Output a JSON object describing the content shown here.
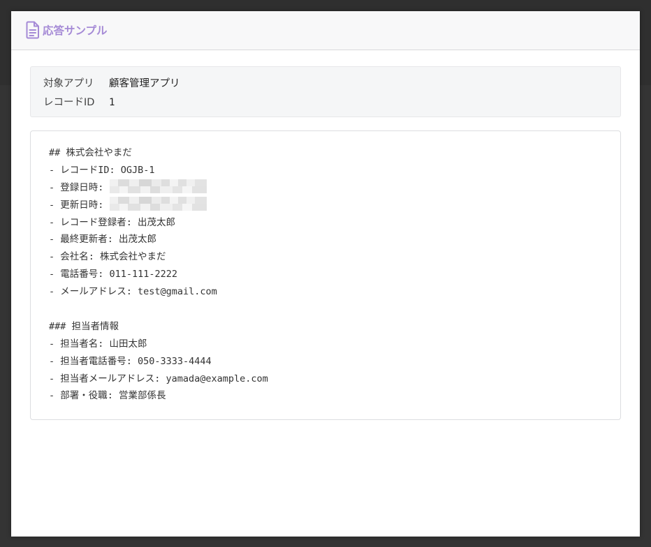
{
  "modal": {
    "title": "応答サンプル",
    "title_icon": "document-icon",
    "accent_color": "#a58ad6"
  },
  "meta": {
    "app_label": "対象アプリ",
    "app_value": "顧客管理アプリ",
    "record_label": "レコードID",
    "record_value": "1"
  },
  "response": {
    "lines": [
      "## 株式会社やまだ",
      "- レコードID: OGJB-1",
      "- 登録日時: ",
      "- 更新日時: ",
      "- レコード登録者: 出茂太郎",
      "- 最終更新者: 出茂太郎",
      "- 会社名: 株式会社やまだ",
      "- 電話番号: 011-111-2222",
      "- メールアドレス: test@gmail.com",
      "",
      "### 担当者情報",
      "- 担当者名: 山田太郎",
      "- 担当者電話番号: 050-3333-4444",
      "- 担当者メールアドレス: yamada@example.com",
      "- 部署・役職: 営業部係長"
    ],
    "redacted_line_indexes": [
      2,
      3
    ]
  }
}
